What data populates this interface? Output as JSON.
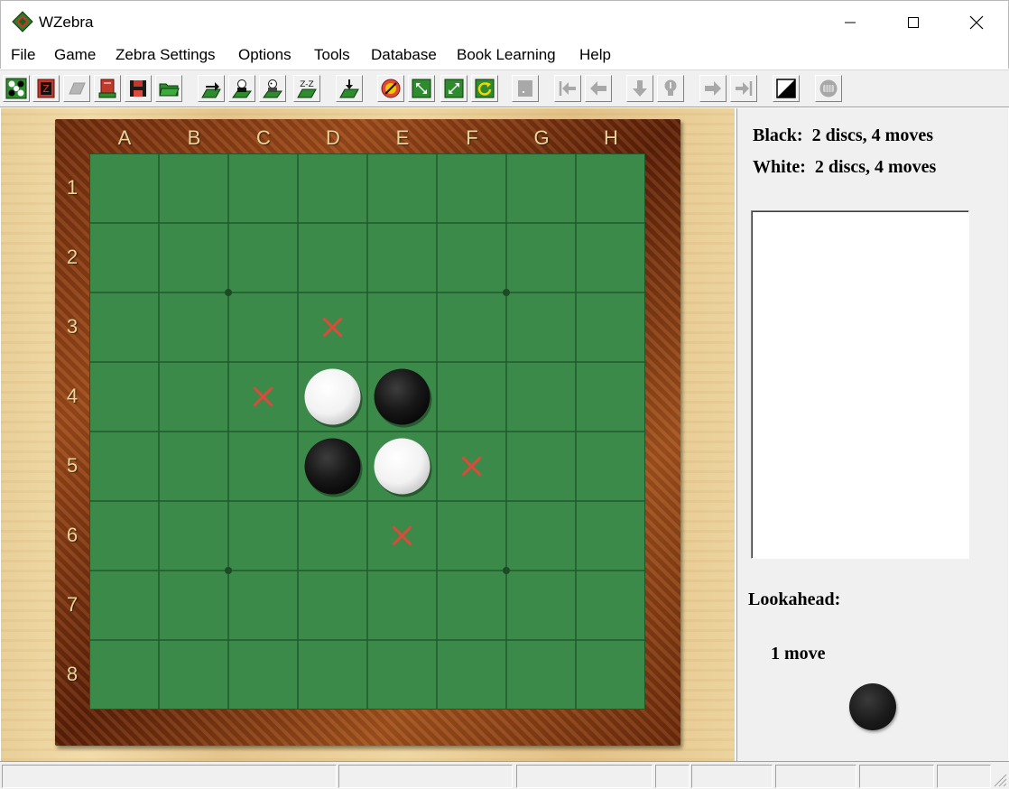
{
  "window": {
    "title": "WZebra",
    "icon": "wzebra-app-icon",
    "controls": [
      "minimize-icon",
      "maximize-icon",
      "close-icon"
    ]
  },
  "menu": {
    "items": [
      "File",
      "Game",
      "Zebra Settings",
      "Options",
      "Tools",
      "Database",
      "Book Learning",
      "Help"
    ]
  },
  "toolbar": {
    "buttons": [
      {
        "icon": "new-game-icon",
        "enabled": true
      },
      {
        "icon": "zebra-book-icon",
        "enabled": true
      },
      {
        "icon": "eraser-icon",
        "enabled": false
      },
      {
        "icon": "save-book-icon",
        "enabled": true
      },
      {
        "icon": "save-disk-icon",
        "enabled": true
      },
      {
        "icon": "open-folder-icon",
        "enabled": true
      },
      {
        "icon": "move-forward-board-icon",
        "enabled": true
      },
      {
        "icon": "person-analyze-icon",
        "enabled": true
      },
      {
        "icon": "person-hint-icon",
        "enabled": true
      },
      {
        "icon": "sleep-zz-icon",
        "enabled": true
      },
      {
        "icon": "download-move-icon",
        "enabled": true
      },
      {
        "icon": "stop-icon",
        "enabled": true
      },
      {
        "icon": "rotate-board-icon",
        "enabled": true
      },
      {
        "icon": "flip-board-icon",
        "enabled": true
      },
      {
        "icon": "refresh-board-icon",
        "enabled": true
      },
      {
        "icon": "blank-page-icon",
        "enabled": false
      },
      {
        "icon": "first-move-icon",
        "enabled": false
      },
      {
        "icon": "previous-move-icon",
        "enabled": false
      },
      {
        "icon": "down-arrow-icon",
        "enabled": false
      },
      {
        "icon": "lightbulb-icon",
        "enabled": false
      },
      {
        "icon": "next-move-icon",
        "enabled": false
      },
      {
        "icon": "last-move-icon",
        "enabled": false
      },
      {
        "icon": "black-white-toggle-icon",
        "enabled": true
      },
      {
        "icon": "abacus-icon",
        "enabled": false
      }
    ]
  },
  "board": {
    "columns": [
      "A",
      "B",
      "C",
      "D",
      "E",
      "F",
      "G",
      "H"
    ],
    "rows": [
      "1",
      "2",
      "3",
      "4",
      "5",
      "6",
      "7",
      "8"
    ],
    "discs": [
      {
        "square": "D4",
        "color": "white"
      },
      {
        "square": "E4",
        "color": "black"
      },
      {
        "square": "D5",
        "color": "black"
      },
      {
        "square": "E5",
        "color": "white"
      }
    ],
    "legal_moves": [
      "D3",
      "C4",
      "F5",
      "E6"
    ],
    "colors": {
      "felt": "#3c8a4a",
      "grid": "#1f5a2a",
      "legal_mark": "#e0483a",
      "coord_text": "#e8d59a"
    }
  },
  "panel": {
    "black_label": "Black:",
    "black_score": "2 discs, 4 moves",
    "white_label": "White:",
    "white_score": "2 discs, 4 moves",
    "lookahead_label": "Lookahead:",
    "lookahead_value": "1 move",
    "side_to_move": "black"
  }
}
